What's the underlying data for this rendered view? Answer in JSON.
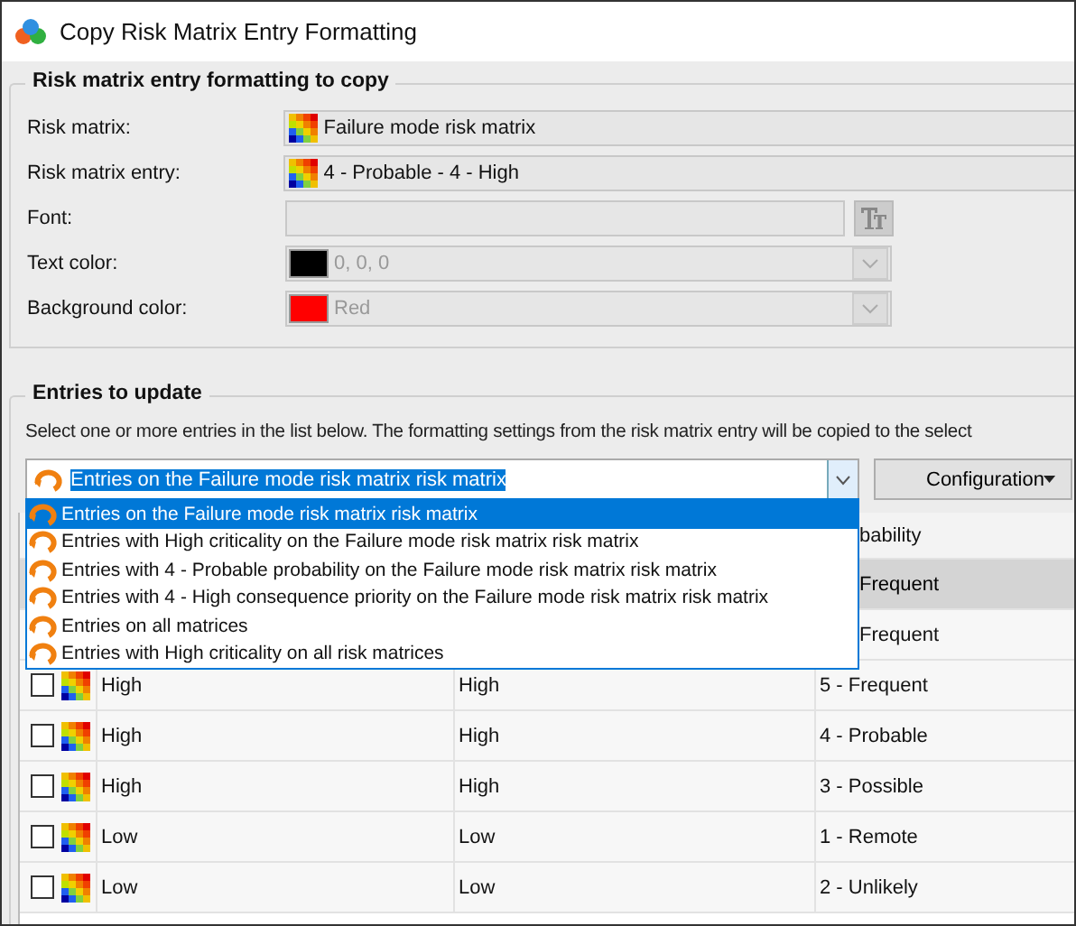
{
  "window": {
    "title": "Copy Risk Matrix Entry Formatting"
  },
  "formatting_group": {
    "title": "Risk matrix entry formatting to copy",
    "fields": [
      {
        "kind": "matrix",
        "label": "Risk matrix:",
        "value": "Failure mode risk matrix"
      },
      {
        "kind": "matrix",
        "label": "Risk matrix entry:",
        "value": "4 - Probable - 4 - High"
      },
      {
        "kind": "font",
        "label": "Font:"
      },
      {
        "kind": "color",
        "label": "Text color:",
        "color": "#000000",
        "value": "0, 0, 0"
      },
      {
        "kind": "color",
        "label": "Background color:",
        "color": "#ff0000",
        "value": "Red"
      }
    ]
  },
  "entries_group": {
    "title": "Entries to update",
    "instructions": "Select one or more entries in the list below.   The formatting settings from the risk matrix entry will be copied to the select",
    "filter": {
      "value": "Entries on the Failure mode risk matrix risk matrix",
      "options": [
        {
          "label": "Entries on the Failure mode risk matrix risk matrix",
          "selected": true
        },
        {
          "label": "Entries with High criticality on the Failure mode risk matrix risk matrix",
          "selected": false
        },
        {
          "label": "Entries with 4 - Probable probability on the Failure mode risk matrix risk matrix",
          "selected": false
        },
        {
          "label": "Entries with 4 - High consequence priority on the Failure mode risk matrix risk matrix",
          "selected": false
        },
        {
          "label": "Entries on all matrices",
          "selected": false
        },
        {
          "label": "Entries with High criticality on all risk matrices",
          "selected": false
        }
      ]
    },
    "configuration_button": "Configuration",
    "table": {
      "column_3_header": "bability",
      "rows": [
        {
          "selected": true,
          "column_3": "Frequent"
        },
        {
          "selected": false,
          "column_3": "Frequent"
        },
        {
          "selected": false,
          "checked": false,
          "column_1": "High",
          "column_2": "High",
          "column_3": "5 - Frequent"
        },
        {
          "selected": false,
          "checked": false,
          "column_1": "High",
          "column_2": "High",
          "column_3": "4 - Probable"
        },
        {
          "selected": false,
          "checked": false,
          "column_1": "High",
          "column_2": "High",
          "column_3": "3 - Possible"
        },
        {
          "selected": false,
          "checked": false,
          "column_1": "Low",
          "column_2": "Low",
          "column_3": "1 - Remote"
        },
        {
          "selected": false,
          "checked": false,
          "column_1": "Low",
          "column_2": "Low",
          "column_3": "2 - Unlikely"
        }
      ]
    }
  }
}
